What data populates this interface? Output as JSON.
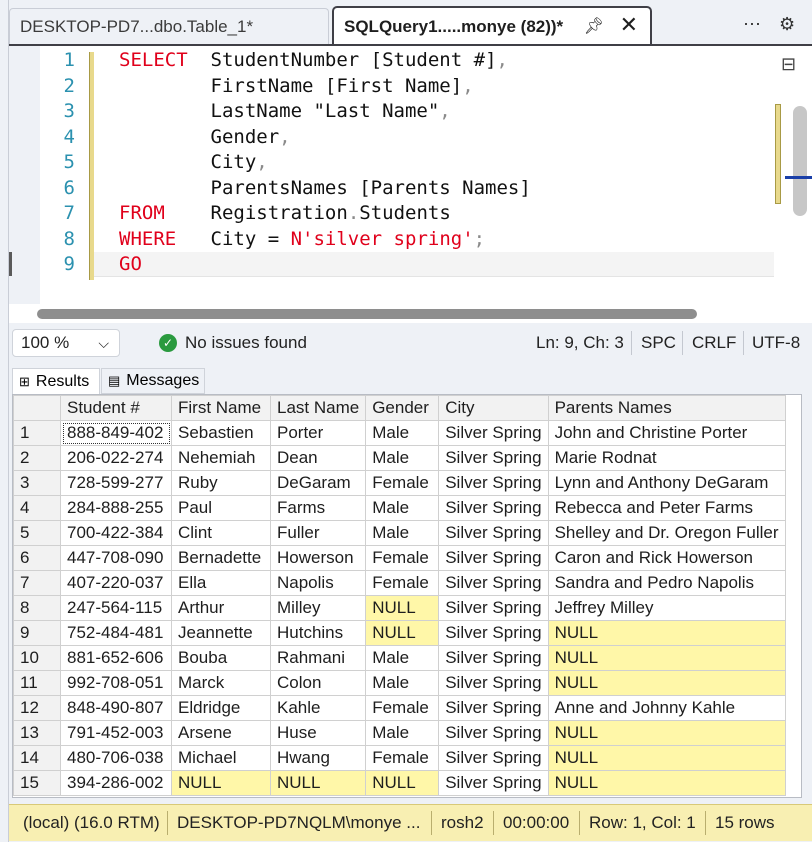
{
  "tabs": {
    "inactive": "DESKTOP-PD7...dbo.Table_1*",
    "active": "SQLQuery1.....monye (82))*"
  },
  "editor": {
    "line_numbers": [
      "1",
      "2",
      "3",
      "4",
      "5",
      "6",
      "7",
      "8",
      "9"
    ],
    "lines": [
      {
        "kw": "SELECT",
        "text": "StudentNumber [Student #]",
        "punc": ","
      },
      {
        "kw": "",
        "text": "FirstName [First Name]",
        "punc": ","
      },
      {
        "kw": "",
        "text": "LastName \"Last Name\"",
        "punc": ","
      },
      {
        "kw": "",
        "text": "Gender",
        "punc": ","
      },
      {
        "kw": "",
        "text": "City",
        "punc": ","
      },
      {
        "kw": "",
        "text": "ParentsNames [Parents Names]",
        "punc": ""
      },
      {
        "kw": "FROM",
        "text": "Registration",
        "punc": ".",
        "text2": "Students"
      },
      {
        "kw": "WHERE",
        "text": "City = ",
        "str": "N'silver spring'",
        "punc": ";"
      },
      {
        "kw": "GO",
        "text": "",
        "punc": ""
      }
    ]
  },
  "status": {
    "zoom": "100 %",
    "issues": "No issues found",
    "position": "Ln: 9, Ch: 3",
    "mode": "SPC",
    "line_ending": "CRLF",
    "encoding": "UTF-8"
  },
  "results_tabs": {
    "results": "Results",
    "messages": "Messages"
  },
  "grid": {
    "columns": [
      "Student #",
      "First Name",
      "Last Name",
      "Gender",
      "City",
      "Parents Names"
    ],
    "rows": [
      [
        "1",
        "888-849-402",
        "Sebastien",
        "Porter",
        "Male",
        "Silver Spring",
        "John and Christine Porter"
      ],
      [
        "2",
        "206-022-274",
        "Nehemiah",
        "Dean",
        "Male",
        "Silver Spring",
        "Marie Rodnat"
      ],
      [
        "3",
        "728-599-277",
        "Ruby",
        "DeGaram",
        "Female",
        "Silver Spring",
        "Lynn and Anthony DeGaram"
      ],
      [
        "4",
        "284-888-255",
        "Paul",
        "Farms",
        "Male",
        "Silver Spring",
        "Rebecca and Peter Farms"
      ],
      [
        "5",
        "700-422-384",
        "Clint",
        "Fuller",
        "Male",
        "Silver Spring",
        "Shelley and Dr. Oregon Fuller"
      ],
      [
        "6",
        "447-708-090",
        "Bernadette",
        "Howerson",
        "Female",
        "Silver Spring",
        "Caron and Rick Howerson"
      ],
      [
        "7",
        "407-220-037",
        "Ella",
        "Napolis",
        "Female",
        "Silver Spring",
        "Sandra and Pedro Napolis"
      ],
      [
        "8",
        "247-564-115",
        "Arthur",
        "Milley",
        "NULL",
        "Silver Spring",
        "Jeffrey Milley"
      ],
      [
        "9",
        "752-484-481",
        "Jeannette",
        "Hutchins",
        "NULL",
        "Silver Spring",
        "NULL"
      ],
      [
        "10",
        "881-652-606",
        "Bouba",
        "Rahmani",
        "Male",
        "Silver Spring",
        "NULL"
      ],
      [
        "11",
        "992-708-051",
        "Marck",
        "Colon",
        "Male",
        "Silver Spring",
        "NULL"
      ],
      [
        "12",
        "848-490-807",
        "Eldridge",
        "Kahle",
        "Female",
        "Silver Spring",
        "Anne and Johnny Kahle"
      ],
      [
        "13",
        "791-452-003",
        "Arsene",
        "Huse",
        "Male",
        "Silver Spring",
        "NULL"
      ],
      [
        "14",
        "480-706-038",
        "Michael",
        "Hwang",
        "Female",
        "Silver Spring",
        "NULL"
      ],
      [
        "15",
        "394-286-002",
        "NULL",
        "NULL",
        "NULL",
        "Silver Spring",
        "NULL"
      ]
    ]
  },
  "bottom": {
    "server": "(local) (16.0 RTM)",
    "login": "DESKTOP-PD7NQLM\\monye ...",
    "database": "rosh2",
    "elapsed": "00:00:00",
    "rowcol": "Row: 1, Col: 1",
    "rows": "15 rows"
  },
  "colors": {
    "keyword": "#e0001b",
    "null_bg": "#fff7a8",
    "status_bar": "#f8efb2"
  }
}
